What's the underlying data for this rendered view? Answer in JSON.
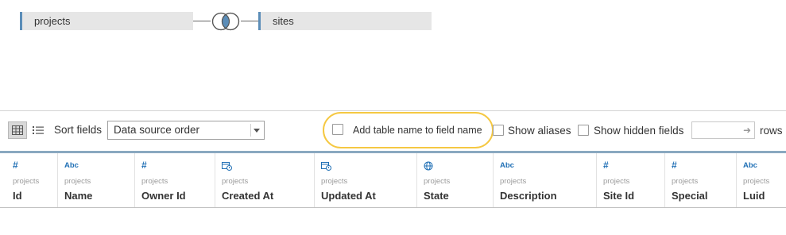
{
  "join": {
    "left_table": "projects",
    "right_table": "sites"
  },
  "toolbar": {
    "sort_label": "Sort fields",
    "sort_value": "Data source order",
    "add_table_name_label": "Add table name to field name",
    "show_aliases_label": "Show aliases",
    "show_hidden_label": "Show hidden fields",
    "rows_label": "rows"
  },
  "columns": [
    {
      "icon": "number-icon",
      "table": "projects",
      "name": "Id"
    },
    {
      "icon": "string-icon",
      "table": "projects",
      "name": "Name"
    },
    {
      "icon": "number-icon",
      "table": "projects",
      "name": "Owner Id"
    },
    {
      "icon": "datetime-icon",
      "table": "projects",
      "name": "Created At"
    },
    {
      "icon": "datetime-icon",
      "table": "projects",
      "name": "Updated At"
    },
    {
      "icon": "globe-icon",
      "table": "projects",
      "name": "State"
    },
    {
      "icon": "string-icon",
      "table": "projects",
      "name": "Description"
    },
    {
      "icon": "number-icon",
      "table": "projects",
      "name": "Site Id"
    },
    {
      "icon": "number-icon",
      "table": "projects",
      "name": "Special"
    },
    {
      "icon": "string-icon",
      "table": "projects",
      "name": "Luid"
    }
  ],
  "icon_glyphs": {
    "number": "#",
    "string": "Abc"
  },
  "colors": {
    "accent": "#1f6fb5",
    "join_bar": "#5b8db8",
    "highlight": "#f5c842"
  }
}
